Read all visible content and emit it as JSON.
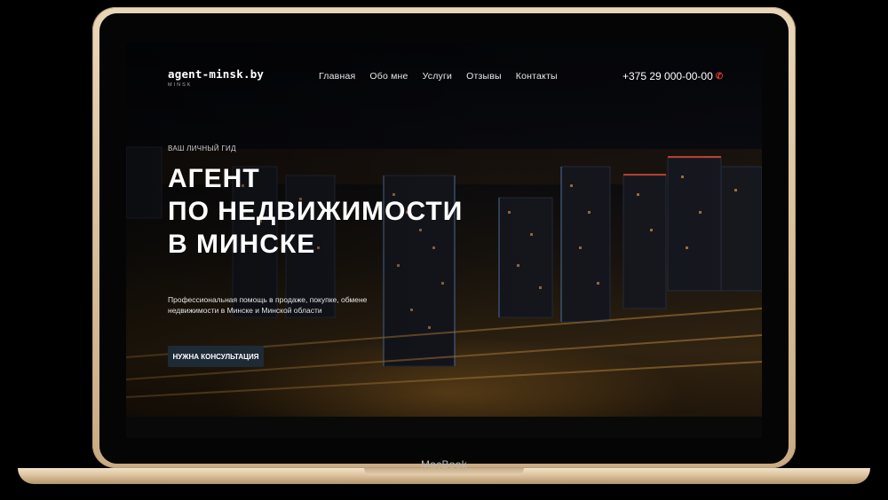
{
  "device": {
    "label": "MacBook"
  },
  "site": {
    "logo": {
      "name": "agent-minsk.by",
      "sub": "MINSK"
    },
    "nav": [
      {
        "label": "Главная"
      },
      {
        "label": "Обо мне"
      },
      {
        "label": "Услуги"
      },
      {
        "label": "Отзывы"
      },
      {
        "label": "Контакты"
      }
    ],
    "phone": "+375 29 000-00-00"
  },
  "hero": {
    "eyebrow": "ВАШ ЛИЧНЫЙ ГИД",
    "title_lines": [
      "АГЕНТ",
      "ПО НЕДВИЖИМОСТИ",
      "В МИНСКЕ"
    ],
    "description_lines": [
      "Профессиональная помощь в продаже, покупке, обмене",
      "недвижимости в Минске и Минской области"
    ],
    "cta_label": "НУЖНА КОНСУЛЬТАЦИЯ"
  },
  "colors": {
    "accent": "#e03a2f",
    "button_bg": "#1e2b36",
    "frame_gold": "#d8c09c"
  },
  "icons": {
    "phone": "phone-icon"
  }
}
